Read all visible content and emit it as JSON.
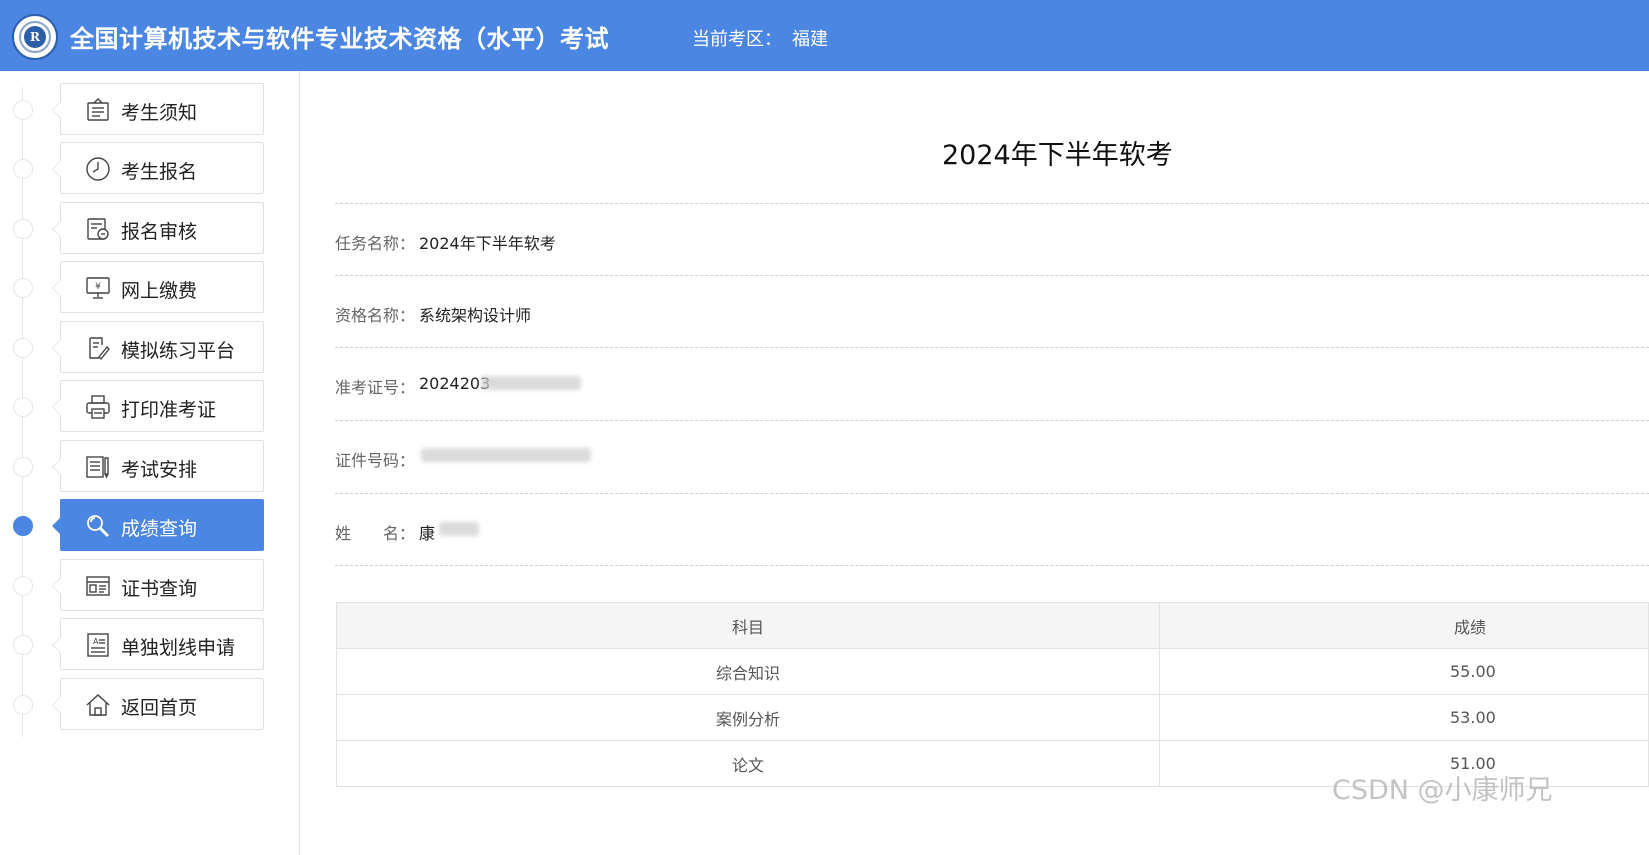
{
  "header": {
    "site_title": "全国计算机技术与软件专业技术资格（水平）考试",
    "region_label": "当前考区：",
    "region_value": "福建",
    "logo_letter": "R"
  },
  "colors": {
    "accent": "#4a86e2",
    "sidebar_border": "#e0e0e0"
  },
  "sidebar": {
    "items": [
      {
        "label": "考生须知",
        "icon": "notice-board-icon",
        "active": false
      },
      {
        "label": "考生报名",
        "icon": "clock-icon",
        "active": false
      },
      {
        "label": "报名审核",
        "icon": "review-document-icon",
        "active": false
      },
      {
        "label": "网上缴费",
        "icon": "payment-monitor-icon",
        "active": false
      },
      {
        "label": "模拟练习平台",
        "icon": "edit-practice-icon",
        "active": false
      },
      {
        "label": "打印准考证",
        "icon": "printer-icon",
        "active": false
      },
      {
        "label": "考试安排",
        "icon": "schedule-document-icon",
        "active": false
      },
      {
        "label": "成绩查询",
        "icon": "search-icon",
        "active": true
      },
      {
        "label": "证书查询",
        "icon": "certificate-icon",
        "active": false
      },
      {
        "label": "单独划线申请",
        "icon": "application-form-icon",
        "active": false
      },
      {
        "label": "返回首页",
        "icon": "home-icon",
        "active": false
      }
    ]
  },
  "main": {
    "title": "2024年下半年软考",
    "info": {
      "task_label": "任务名称：",
      "task_value": "2024年下半年软考",
      "qualification_label": "资格名称：",
      "qualification_value": "系统架构设计师",
      "ticket_label": "准考证号：",
      "ticket_value": "2024203",
      "id_label": "证件号码：",
      "id_value": "",
      "name_label": "姓　　名：",
      "name_value": "康"
    },
    "scores": {
      "headers": [
        "科目",
        "成绩"
      ],
      "rows": [
        {
          "subject": "综合知识",
          "score": "55.00"
        },
        {
          "subject": "案例分析",
          "score": "53.00"
        },
        {
          "subject": "论文",
          "score": "51.00"
        }
      ]
    }
  },
  "watermark": "CSDN @小康师兄"
}
